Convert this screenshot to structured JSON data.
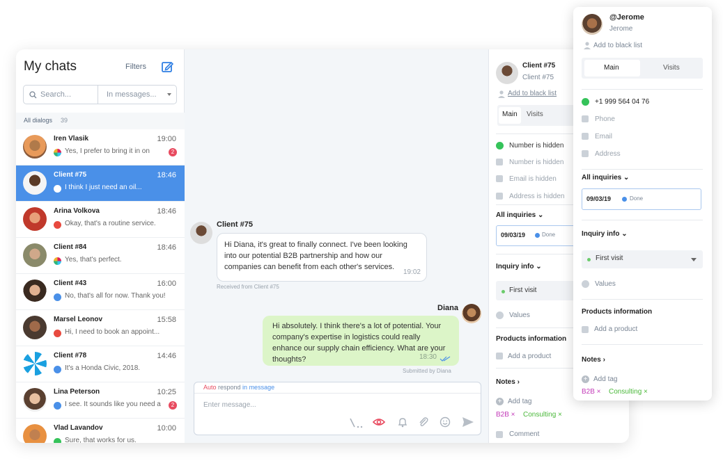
{
  "sidebar": {
    "title": "My chats",
    "filters_label": "Filters",
    "search_placeholder": "Search...",
    "scope_label": "In messages...",
    "dialogs_label": "All dialogs",
    "dialogs_count": "39",
    "chats": [
      {
        "name": "Iren Vlasik",
        "time": "19:00",
        "preview": "Yes, I prefer to bring it in on",
        "badge": "2",
        "channel": "slack"
      },
      {
        "name": "Client #75",
        "time": "18:46",
        "preview": "I think I just need an oil...",
        "badge": "",
        "channel": "web"
      },
      {
        "name": "Arina Volkova",
        "time": "18:46",
        "preview": "Okay, that's a routine service.",
        "badge": "",
        "channel": "red"
      },
      {
        "name": "Client #84",
        "time": "18:46",
        "preview": "Yes, that's perfect.",
        "badge": "",
        "channel": "slack"
      },
      {
        "name": "Client #43",
        "time": "16:00",
        "preview": "No, that's all for now. Thank you!",
        "badge": "",
        "channel": "blue"
      },
      {
        "name": "Marsel Leonov",
        "time": "15:58",
        "preview": "Hi, I need to book an appoint...",
        "badge": "",
        "channel": "red"
      },
      {
        "name": "Client #78",
        "time": "14:46",
        "preview": "It's a Honda Civic, 2018.",
        "badge": "",
        "channel": "blue"
      },
      {
        "name": "Lina Peterson",
        "time": "10:25",
        "preview": "I see. It sounds like you need a",
        "badge": "2",
        "channel": "blue"
      },
      {
        "name": "Vlad Lavandov",
        "time": "10:00",
        "preview": "Sure, that works for us.",
        "badge": "",
        "channel": "green"
      }
    ]
  },
  "conversation": {
    "incoming": {
      "author": "Client #75",
      "text": "Hi Diana, it's great to finally connect. I've been looking into our potential B2B partnership and how our companies can benefit from each other's services.",
      "time": "19:02",
      "footnote": "Received from Client #75"
    },
    "outgoing": {
      "author": "Diana",
      "text": "Hi absolutely. I think there's a lot of potential. Your company's expertise in logistics could really enhance our supply chain efficiency. What are your thoughts?",
      "time": "18:30",
      "footnote": "Submitted by Diana"
    },
    "composer": {
      "auto_word": "Auto",
      "respond_word": " respond ",
      "in_word": "in",
      "message_word": " message",
      "placeholder": "Enter message..."
    }
  },
  "client_panel": {
    "name": "Client #75",
    "handle": "Client #75",
    "blacklist": "Add to black list",
    "tab_main": "Main",
    "tab_visits": "Visits",
    "number": "Number is hidden",
    "phone": "Number is hidden",
    "email": "Email is hidden",
    "address": "Address is hidden",
    "inquiries_label": "All inquiries",
    "inquiry_date": "09/03/19",
    "inquiry_status": "Done",
    "inquiry_info_label": "Inquiry info",
    "visit": "First visit",
    "values": "Values",
    "products_label": "Products information",
    "add_product": "Add a product",
    "notes_label": "Notes",
    "add_tag": "Add tag",
    "tag1": "B2B",
    "tag2": "Consulting",
    "comment": "Comment"
  },
  "popup": {
    "name": "@Jerome",
    "handle": "Jerome",
    "blacklist": "Add to black list",
    "tab_main": "Main",
    "tab_visits": "Visits",
    "whatsapp": "+1 999 564 04 76",
    "phone": "Phone",
    "email": "Email",
    "address": "Address",
    "inquiries_label": "All inquiries",
    "inquiry_date": "09/03/19",
    "inquiry_status": "Done",
    "inquiry_info_label": "Inquiry info",
    "visit": "First visit",
    "values": "Values",
    "products_label": "Products information",
    "add_product": "Add a product",
    "notes_label": "Notes",
    "add_tag": "Add tag",
    "tag1": "B2B",
    "tag2": "Consulting"
  },
  "colors": {
    "accent": "#4a90e8",
    "badge": "#e84a5f",
    "outgoing_bubble": "#dcf5c8",
    "tag_b2b": "#c23ab8",
    "tag_consulting": "#4ab83a",
    "whatsapp": "#35c35a"
  }
}
